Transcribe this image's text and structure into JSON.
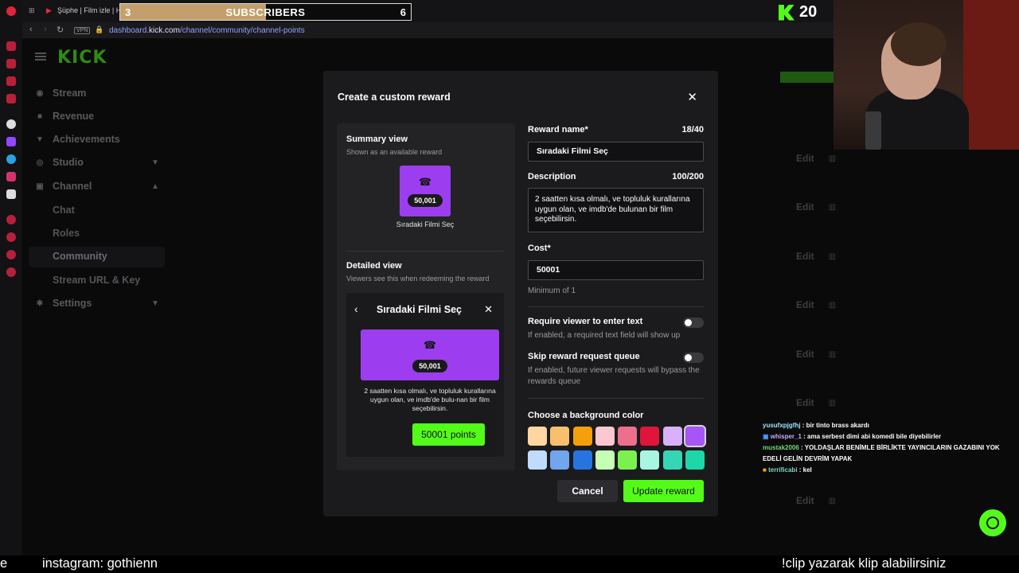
{
  "browser": {
    "tab_title": "Şüphe | Film izle | H",
    "url_host": "dashboard.",
    "url_domain": "kick.com",
    "url_path": "/channel/community/channel-points"
  },
  "overlay": {
    "subs_left": "3",
    "subs_title": "SUBSCRIBERS",
    "subs_right": "6",
    "subs_progress": 0.5,
    "kick_count": "20"
  },
  "dashboard": {
    "logo": "KICK",
    "nav": [
      {
        "label": "Stream",
        "icon": "stream-icon"
      },
      {
        "label": "Revenue",
        "icon": "revenue-icon"
      },
      {
        "label": "Achievements",
        "icon": "trophy-icon"
      },
      {
        "label": "Studio",
        "icon": "studio-icon"
      },
      {
        "label": "Channel",
        "icon": "channel-icon"
      }
    ],
    "channel_sub": [
      "Chat",
      "Roles",
      "Community",
      "Stream URL & Key"
    ],
    "settings": "Settings",
    "edit_label": "Edit"
  },
  "modal": {
    "title": "Create a custom reward",
    "summary_title": "Summary view",
    "summary_sub": "Shown as an available reward",
    "reward_points": "50,001",
    "reward_caption": "Sıradaki Filmi Seç",
    "detailed_title": "Detailed view",
    "detailed_sub": "Viewers see this when redeeming the reward",
    "detail_title": "Sıradaki Filmi Seç",
    "detail_desc": "2 saatten kısa olmalı, ve topluluk kurallarına uygun olan, ve imdb'de bulu-nan bir film seçebilirsin.",
    "detail_points_btn": "50001 points",
    "reward_name_label": "Reward name*",
    "reward_name_count": "18/40",
    "reward_name_value": "Sıradaki Filmi Seç",
    "description_label": "Description",
    "description_count": "100/200",
    "description_value": "2 saatten kısa olmalı, ve topluluk kurallarına uygun olan, ve imdb'de bulunan bir film seçebilirsin.",
    "cost_label": "Cost*",
    "cost_value": "50001",
    "cost_hint": "Minimum of 1",
    "require_text_label": "Require viewer to enter text",
    "require_text_hint": "If enabled, a required text field will show up",
    "skip_queue_label": "Skip reward request queue",
    "skip_queue_hint": "If enabled, future viewer requests will bypass the rewards queue",
    "bg_color_label": "Choose a background color",
    "colors": [
      "#ffd6a0",
      "#f8c06c",
      "#f59f0b",
      "#fbc7d0",
      "#ec6f8d",
      "#e0143c",
      "#d9b1fa",
      "#a855f7",
      "#bfdbfe",
      "#72a5ef",
      "#2774e0",
      "#c6ffb4",
      "#7bf150",
      "#a8f5e2",
      "#35d6b5",
      "#1ed7a8"
    ],
    "cancel": "Cancel",
    "update": "Update reward"
  },
  "chat": [
    {
      "user": "yusufxpjgfhj",
      "color": "#9fe4ff",
      "text": " : bir tinto brass akardı"
    },
    {
      "user": "whisper_1",
      "color": "#c8a8ff",
      "text": " : ama serbest dimi abi komedi bile diyebilirler"
    },
    {
      "user": "mustak2006",
      "color": "#74d66e",
      "text": " : YOLDAŞLAR BENİMLE BİRLİKTE YAYINCILARIN GAZABINI YOK EDELİ GELİN DEVRİM YAPAK"
    },
    {
      "user": "terrificabi",
      "color": "#7fd6c2",
      "text": " : kel"
    }
  ],
  "bottom": {
    "left_char": "e",
    "instagram": "instagram: gothienn",
    "clip": "!clip yazarak klip alabilirsiniz"
  }
}
